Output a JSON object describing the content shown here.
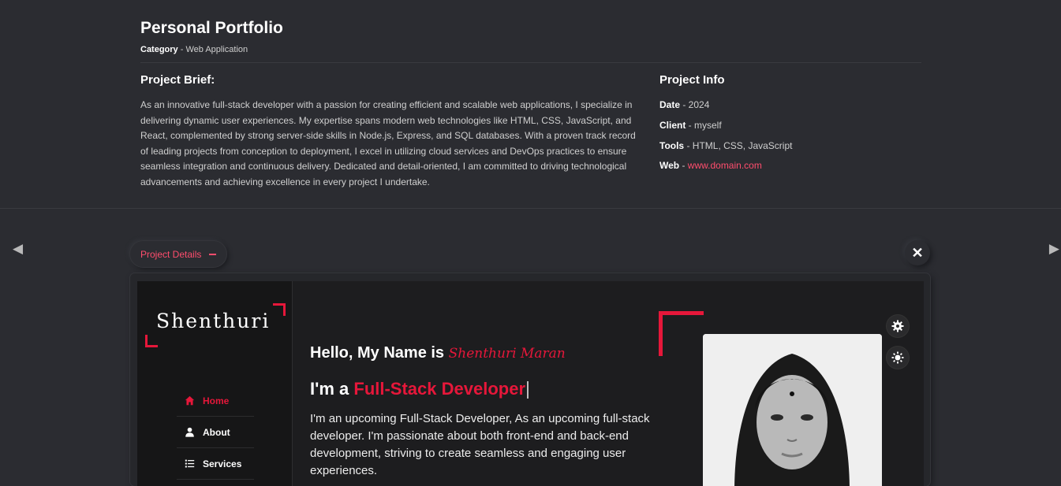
{
  "header": {
    "title": "Personal Portfolio",
    "category_label": "Category",
    "category_value": " - Web Application"
  },
  "brief": {
    "title": "Project Brief:",
    "text": "As an innovative full-stack developer with a passion for creating efficient and scalable web applications, I specialize in delivering dynamic user experiences. My expertise spans modern web technologies like HTML, CSS, JavaScript, and React, complemented by strong server-side skills in Node.js, Express, and SQL databases. With a proven track record of leading projects from conception to deployment, I excel in utilizing cloud services and DevOps practices to ensure seamless integration and continuous delivery. Dedicated and detail-oriented, I am committed to driving technological advancements and achieving excellence in every project I undertake."
  },
  "info": {
    "title": "Project Info",
    "date_label": "Date",
    "date_value": " - 2024",
    "client_label": "Client",
    "client_value": " - myself",
    "tools_label": "Tools",
    "tools_value": " - HTML, CSS, JavaScript",
    "web_label": "Web",
    "web_sep": " - ",
    "web_value": "www.domain.com"
  },
  "controls": {
    "prev_icon": "◀",
    "next_icon": "▶",
    "details_label": "Project Details",
    "close_icon": "✕"
  },
  "preview": {
    "logo": "Shenthuri",
    "menu": [
      {
        "label": "Home",
        "icon": "home-icon",
        "active": true
      },
      {
        "label": "About",
        "icon": "user-icon",
        "active": false
      },
      {
        "label": "Services",
        "icon": "list-icon",
        "active": false
      }
    ],
    "hello_prefix": "Hello, My Name is ",
    "hello_name": "Shenthuri Maran",
    "role_prefix": "I'm a ",
    "role_accent": "Full-Stack Developer",
    "description": "I'm an upcoming Full-Stack Developer, As an upcoming full-stack developer. I'm passionate about both front-end and back-end development, striving to create seamless and engaging user experiences."
  },
  "colors": {
    "background": "#2b2c31",
    "accent_pink": "#ff4d6d",
    "accent_red": "#e6173a"
  }
}
